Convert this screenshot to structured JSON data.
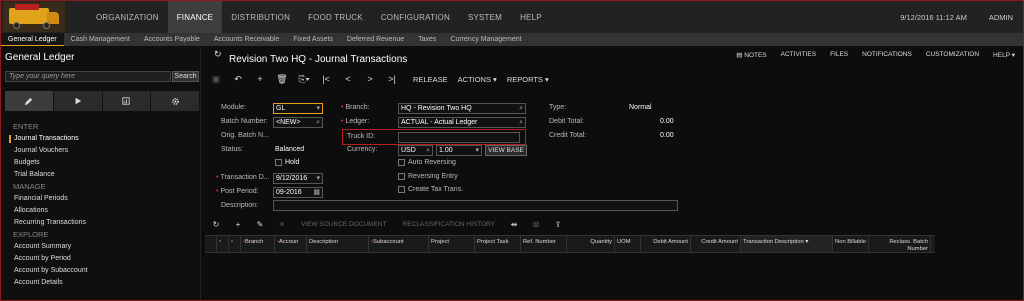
{
  "top": {
    "modules": [
      "ORGANIZATION",
      "FINANCE",
      "DISTRIBUTION",
      "FOOD TRUCK",
      "CONFIGURATION",
      "SYSTEM",
      "HELP"
    ],
    "active_module": "FINANCE",
    "datetime": "9/12/2016  11:12 AM",
    "user": "ADMIN"
  },
  "subnav": {
    "items": [
      "General Ledger",
      "Cash Management",
      "Accounts Payable",
      "Accounts Receivable",
      "Fixed Assets",
      "Deferred Revenue",
      "Taxes",
      "Currency Management"
    ],
    "active": "General Ledger"
  },
  "sidebar": {
    "title": "General Ledger",
    "search_placeholder": "Type your query here",
    "search_button": "Search",
    "tab_icons": [
      "pencil-icon",
      "play-icon",
      "report-icon",
      "gear-icon"
    ],
    "sections": [
      {
        "label": "ENTER",
        "items": [
          "Journal Transactions",
          "Journal Vouchers",
          "Budgets",
          "Trial Balance"
        ]
      },
      {
        "label": "MANAGE",
        "items": [
          "Financial Periods",
          "Allocations",
          "Recurring Transactions"
        ]
      },
      {
        "label": "EXPLORE",
        "items": [
          "Account Summary",
          "Account by Period",
          "Account by Subaccount",
          "Account Details"
        ]
      }
    ],
    "active_item": "Journal Transactions"
  },
  "main": {
    "title": "Revision Two HQ",
    "title_sep": "-",
    "page_title": "Journal Transactions",
    "links": [
      "NOTES",
      "ACTIVITIES",
      "FILES",
      "NOTIFICATIONS",
      "CUSTOMIZATION",
      "HELP"
    ],
    "toolbar": {
      "release": "RELEASE",
      "actions": "ACTIONS",
      "reports": "REPORTS"
    }
  },
  "form": {
    "module_label": "Module:",
    "module_value": "GL",
    "batch_label": "Batch Number:",
    "batch_value": "<NEW>",
    "orig_batch_label": "Orig. Batch N...",
    "status_label": "Status:",
    "status_value": "Balanced",
    "hold_label": "Hold",
    "tran_date_label": "Transaction D...",
    "tran_date_value": "9/12/2016",
    "post_period_label": "Post Period:",
    "post_period_value": "09-2016",
    "description_label": "Description:",
    "branch_label": "Branch:",
    "branch_value": "HQ - Revision Two HQ",
    "ledger_label": "Ledger:",
    "ledger_value": "ACTUAL - Actual Ledger",
    "truck_label": "Truck ID:",
    "currency_label": "Currency:",
    "currency_value": "USD",
    "rate_value": "1.00",
    "view_base": "VIEW BASE",
    "auto_reversing": "Auto Reversing",
    "reversing_entry": "Reversing Entry",
    "create_tax": "Create Tax Trans.",
    "type_label": "Type:",
    "type_value": "Normal",
    "debit_label": "Debit Total:",
    "debit_value": "0.00",
    "credit_label": "Credit Total:",
    "credit_value": "0.00"
  },
  "grid": {
    "view_source": "VIEW SOURCE DOCUMENT",
    "reclass_history": "RECLASSIFICATION HISTORY",
    "columns": [
      "Branch",
      "Accoun",
      "Description",
      "Subaccount",
      "Project",
      "Project Task",
      "Ref. Number",
      "Quantity",
      "UOM",
      "Debit Amount",
      "Credit Amount",
      "Transaction Description",
      "Non Billable",
      "Reclass. Batch Number"
    ]
  }
}
